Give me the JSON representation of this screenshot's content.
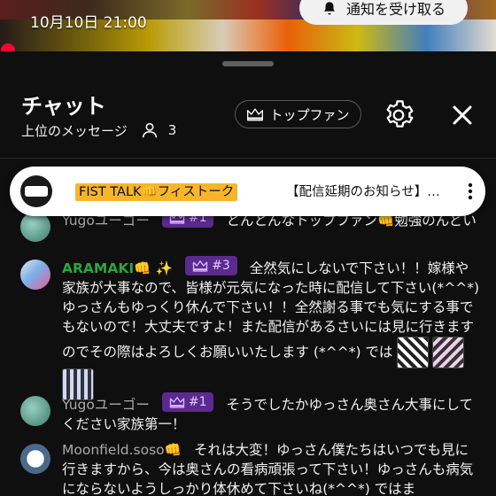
{
  "video": {
    "date": "10月10日 21:00",
    "notify_label": "通知を受け取る",
    "colors": {
      "progress": "#ff0033"
    }
  },
  "header": {
    "title": "チャット",
    "subtitle": "上位のメッセージ",
    "viewer_count": "3",
    "topfan_label": "トップファン"
  },
  "pinned": {
    "author": "FIST TALK👊フィストーク",
    "text": "【配信延期のお知らせ】…",
    "author_color": "#f7b52c"
  },
  "messages": [
    {
      "author": "Yugoユーゴー",
      "badge": "#1",
      "text": "とんとんなトップファン👊勉強のんどい"
    },
    {
      "author": "ARAMAKI👊 ✨",
      "badge": "#3",
      "text": "全然気にしないで下さい！！嫁様や家族が大事なので、皆様が元気になった時に配信して下さい(*^^*) ゆっさんもゆっくり休んで下さい！！全然謝る事でも気にする事でもないので！大丈夫ですよ！また配信があるさいには見に行きますのでその際はよろしくお願いいたします (*^^*) では"
    },
    {
      "author": "Yugoユーゴー",
      "badge": "#1",
      "text": "そうでしたかゆっさん奥さん大事にしてください家族第一！"
    },
    {
      "author": "Moonfield.soso👊",
      "badge": "",
      "text": "それは大変！ゆっさん僕たちはいつでも見に行きますから、今は奥さんの看病頑張って下さい！ゆっさんも病気にならないようしっかり体休めて下さいね(*^^*) ではま"
    }
  ],
  "badge_color": "#5b2a8e"
}
